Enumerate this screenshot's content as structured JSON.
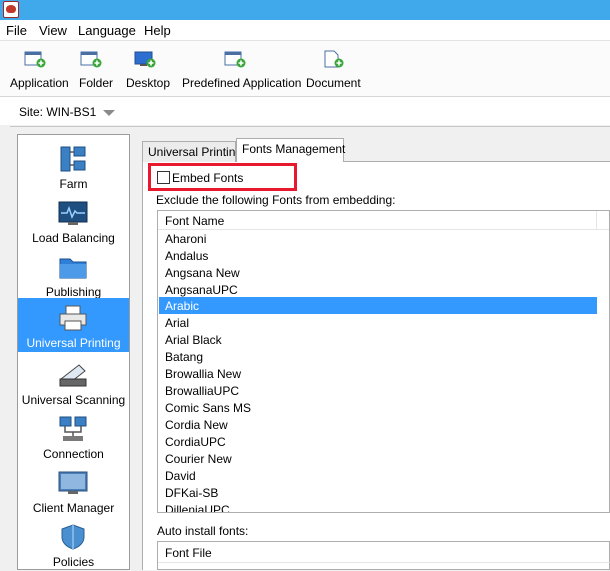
{
  "menu": {
    "items": [
      "File",
      "View",
      "Language",
      "Help"
    ]
  },
  "toolbar": {
    "buttons": [
      {
        "label": "Application",
        "icon": "add-application-icon"
      },
      {
        "label": "Folder",
        "icon": "add-folder-icon"
      },
      {
        "label": "Desktop",
        "icon": "add-desktop-icon"
      },
      {
        "label": "Predefined Application",
        "icon": "add-predefined-application-icon"
      },
      {
        "label": "Document",
        "icon": "add-document-icon"
      }
    ]
  },
  "site": {
    "label": "Site: WIN-BS1"
  },
  "sidebar": {
    "items": [
      {
        "label": "Farm",
        "icon": "farm-icon"
      },
      {
        "label": "Load Balancing",
        "icon": "load-balancing-icon"
      },
      {
        "label": "Publishing",
        "icon": "publishing-icon"
      },
      {
        "label": "Universal Printing",
        "icon": "printer-icon",
        "selected": true
      },
      {
        "label": "Universal Scanning",
        "icon": "scanner-icon"
      },
      {
        "label": "Connection",
        "icon": "connection-icon"
      },
      {
        "label": "Client Manager",
        "icon": "client-manager-icon"
      },
      {
        "label": "Policies",
        "icon": "policies-icon"
      }
    ]
  },
  "tabs": [
    {
      "label": "Universal Printing",
      "active": false
    },
    {
      "label": "Fonts Management",
      "active": true
    }
  ],
  "fonts_management": {
    "embed_fonts_label": "Embed Fonts",
    "embed_fonts_checked": false,
    "exclude_label": "Exclude the following Fonts from embedding:",
    "font_list_header": "Font Name",
    "fonts": [
      "Aharoni",
      "Andalus",
      "Angsana New",
      "AngsanaUPC",
      "Arabic",
      "Arial",
      "Arial Black",
      "Batang",
      "Browallia New",
      "BrowalliaUPC",
      "Comic Sans MS",
      "Cordia New",
      "CordiaUPC",
      "Courier New",
      "David",
      "DFKai-SB",
      "DilleniaUPC"
    ],
    "selected_font": "Arabic",
    "auto_install_label": "Auto install fonts:",
    "font_file_header": "Font File"
  },
  "colors": {
    "selection": "#3399ff",
    "highlight_border": "#e8192c",
    "titlebar": "#3fa9ec"
  }
}
